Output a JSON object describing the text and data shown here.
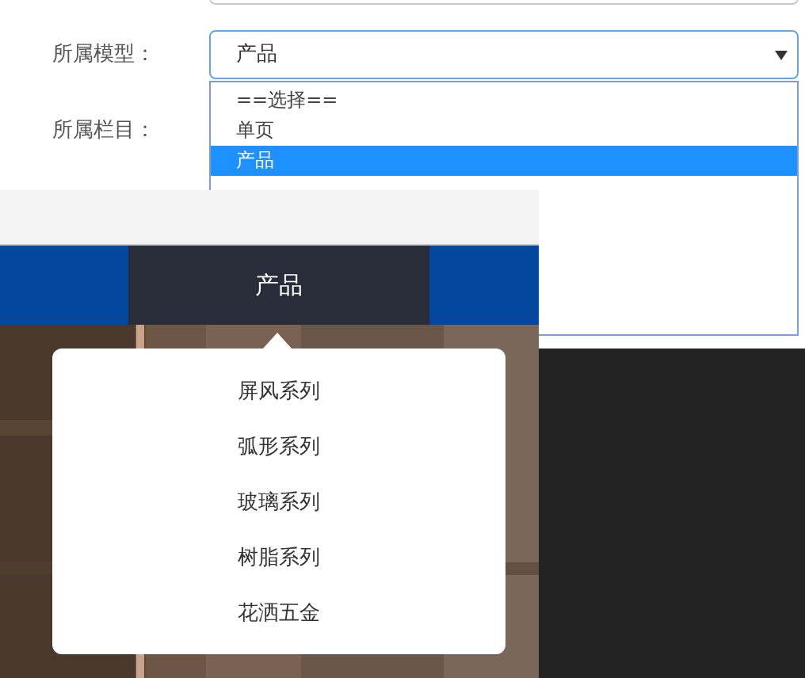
{
  "form": {
    "fields": [
      {
        "label": "所属模型：",
        "value": "产品"
      },
      {
        "label": "所属栏目："
      }
    ],
    "model_options": [
      {
        "label": "==选择==",
        "selected": false
      },
      {
        "label": "单页",
        "selected": false
      },
      {
        "label": "产品",
        "selected": true
      }
    ]
  },
  "site_preview": {
    "nav": [
      {
        "label": "产品",
        "selected": true
      }
    ],
    "submenu": [
      {
        "label": "屏风系列"
      },
      {
        "label": "弧形系列"
      },
      {
        "label": "玻璃系列"
      },
      {
        "label": "树脂系列"
      },
      {
        "label": "花洒五金"
      }
    ]
  }
}
